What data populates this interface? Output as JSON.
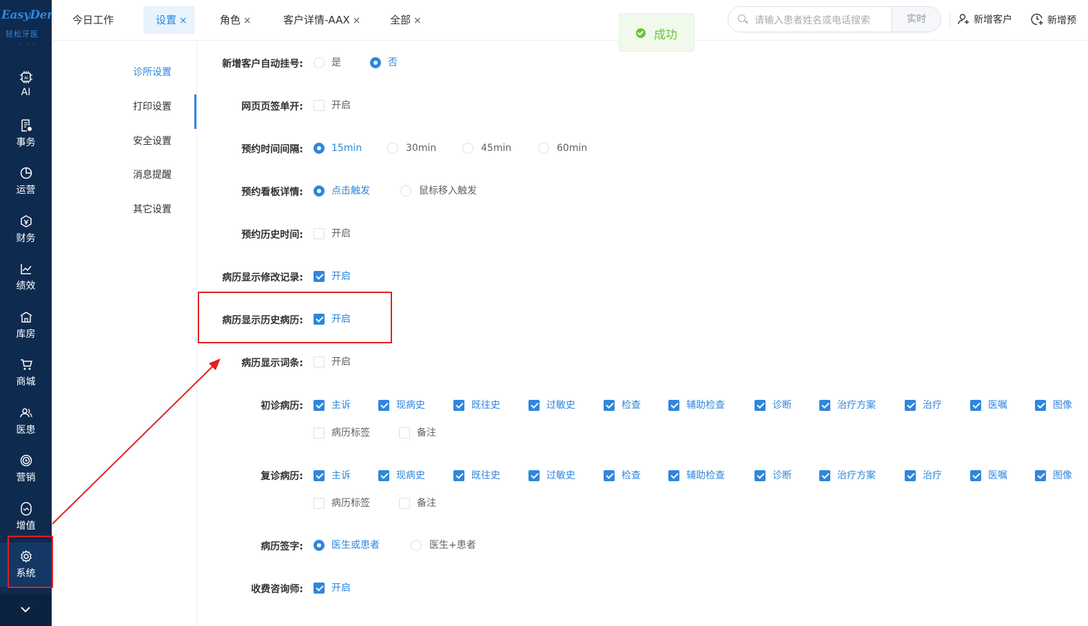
{
  "sidebar": {
    "brand": "EasyDent",
    "brand_sub": "轻松牙医",
    "dots": "· · ·",
    "items": [
      {
        "label": "AI",
        "icon": "ai-chip-icon"
      },
      {
        "label": "事务",
        "icon": "task-doc-icon"
      },
      {
        "label": "运营",
        "icon": "pie-chart-icon"
      },
      {
        "label": "财务",
        "icon": "finance-icon"
      },
      {
        "label": "绩效",
        "icon": "line-chart-icon"
      },
      {
        "label": "库房",
        "icon": "warehouse-icon"
      },
      {
        "label": "商城",
        "icon": "cart-icon"
      },
      {
        "label": "医患",
        "icon": "users-icon"
      },
      {
        "label": "营销",
        "icon": "target-icon"
      },
      {
        "label": "增值",
        "icon": "value-added-icon"
      },
      {
        "label": "系统",
        "icon": "gear-icon"
      }
    ],
    "active": "系统"
  },
  "tabs": [
    {
      "label": "今日工作",
      "closable": false
    },
    {
      "label": "设置",
      "closable": true,
      "active": true
    },
    {
      "label": "角色",
      "closable": true
    },
    {
      "label": "客户详情-AAX",
      "closable": true
    },
    {
      "label": "全部",
      "closable": true
    }
  ],
  "tab_close_glyph": "×",
  "toast": {
    "message": "成功",
    "color": "#67c23a"
  },
  "search": {
    "placeholder": "请输入患者姓名或电话搜索",
    "button": "实时"
  },
  "actions": {
    "new_customer": "新增客户",
    "new_appointment": "新增预"
  },
  "submenu": [
    {
      "label": "诊所设置",
      "active": true
    },
    {
      "label": "打印设置"
    },
    {
      "label": "安全设置"
    },
    {
      "label": "消息提醒"
    },
    {
      "label": "其它设置"
    }
  ],
  "settings": {
    "auto_register": {
      "label": "新增客户自动挂号:",
      "options": [
        "是",
        "否"
      ],
      "selected": "否"
    },
    "web_tab_single": {
      "label": "网页页签单开:",
      "option": "开启",
      "checked": false
    },
    "appt_interval": {
      "label": "预约时间间隔:",
      "options": [
        "15min",
        "30min",
        "45min",
        "60min"
      ],
      "selected": "15min"
    },
    "appt_board": {
      "label": "预约看板详情:",
      "options": [
        "点击触发",
        "鼠标移入触发"
      ],
      "selected": "点击触发"
    },
    "appt_history_time": {
      "label": "预约历史时间:",
      "option": "开启",
      "checked": false
    },
    "record_edit_log": {
      "label": "病历显示修改记录:",
      "option": "开启",
      "checked": true
    },
    "record_history": {
      "label": "病历显示历史病历:",
      "option": "开启",
      "checked": true
    },
    "record_terms": {
      "label": "病历显示词条:",
      "option": "开启",
      "checked": false
    },
    "first_visit": {
      "label": "初诊病历:",
      "items": [
        {
          "label": "主诉",
          "checked": true
        },
        {
          "label": "现病史",
          "checked": true
        },
        {
          "label": "既往史",
          "checked": true
        },
        {
          "label": "过敏史",
          "checked": true
        },
        {
          "label": "检查",
          "checked": true
        },
        {
          "label": "辅助检查",
          "checked": true
        },
        {
          "label": "诊断",
          "checked": true
        },
        {
          "label": "治疗方案",
          "checked": true
        },
        {
          "label": "治疗",
          "checked": true
        },
        {
          "label": "医嘱",
          "checked": true
        },
        {
          "label": "图像",
          "checked": true
        },
        {
          "label": "病历标签",
          "checked": false
        },
        {
          "label": "备注",
          "checked": false
        }
      ]
    },
    "return_visit": {
      "label": "复诊病历:",
      "items": [
        {
          "label": "主诉",
          "checked": true
        },
        {
          "label": "现病史",
          "checked": true
        },
        {
          "label": "既往史",
          "checked": true
        },
        {
          "label": "过敏史",
          "checked": true
        },
        {
          "label": "检查",
          "checked": true
        },
        {
          "label": "辅助检查",
          "checked": true
        },
        {
          "label": "诊断",
          "checked": true
        },
        {
          "label": "治疗方案",
          "checked": true
        },
        {
          "label": "治疗",
          "checked": true
        },
        {
          "label": "医嘱",
          "checked": true
        },
        {
          "label": "图像",
          "checked": true
        },
        {
          "label": "病历标签",
          "checked": false
        },
        {
          "label": "备注",
          "checked": false
        }
      ]
    },
    "record_signature": {
      "label": "病历签字:",
      "options": [
        "医生或患者",
        "医生+患者"
      ],
      "selected": "医生或患者"
    },
    "charge_consultant": {
      "label": "收费咨询师:",
      "option": "开启",
      "checked": true
    }
  },
  "colors": {
    "primary": "#2f86dd",
    "sidebar_bg": "#0e2a4f",
    "annotation": "#e02020",
    "success": "#67c23a"
  }
}
